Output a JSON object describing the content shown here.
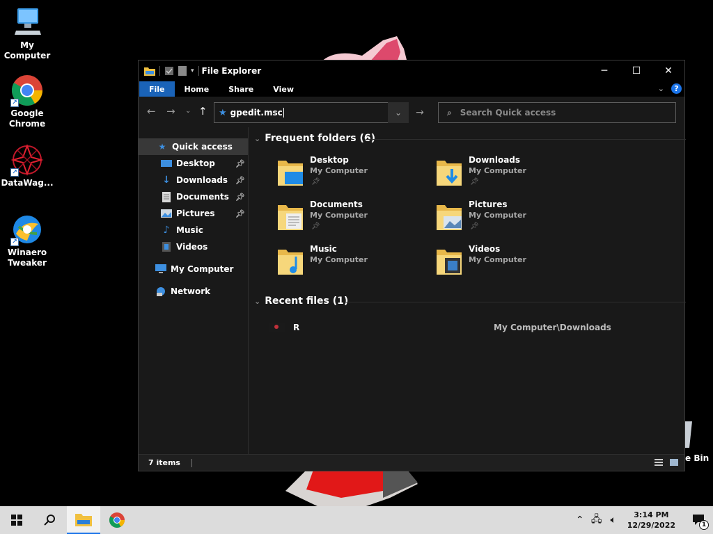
{
  "desktop": {
    "icons": [
      {
        "label": "My\nComputer",
        "name": "my-computer"
      },
      {
        "label": "Google\nChrome",
        "name": "google-chrome"
      },
      {
        "label": "DataWag...",
        "name": "datawag"
      },
      {
        "label": "Winaero\nTweaker",
        "name": "winaero-tweaker"
      }
    ],
    "recycle_bin_fragment": "e Bin"
  },
  "window": {
    "title": "File Explorer",
    "controls": {
      "minimize": "─",
      "maximize": "☐",
      "close": "✕"
    }
  },
  "ribbon": {
    "tabs": [
      "File",
      "Home",
      "Share",
      "View"
    ]
  },
  "address_bar": {
    "value": "gpedit.msc"
  },
  "search": {
    "placeholder": "Search Quick access"
  },
  "nav_pane": {
    "items": [
      {
        "label": "Quick access",
        "icon": "star-icon",
        "selected": true
      },
      {
        "label": "Desktop",
        "icon": "desktop-icon",
        "pinned": true
      },
      {
        "label": "Downloads",
        "icon": "download-icon",
        "pinned": true
      },
      {
        "label": "Documents",
        "icon": "document-icon",
        "pinned": true
      },
      {
        "label": "Pictures",
        "icon": "pictures-icon",
        "pinned": true
      },
      {
        "label": "Music",
        "icon": "music-icon"
      },
      {
        "label": "Videos",
        "icon": "video-icon"
      },
      {
        "label": "My Computer",
        "icon": "computer-icon"
      },
      {
        "label": "Network",
        "icon": "network-icon"
      }
    ]
  },
  "frequent": {
    "heading": "Frequent folders (6)",
    "folders": [
      {
        "name": "Desktop",
        "location": "My Computer",
        "pinned": true,
        "icon": "desktop-folder-icon"
      },
      {
        "name": "Downloads",
        "location": "My Computer",
        "pinned": true,
        "icon": "downloads-folder-icon"
      },
      {
        "name": "Documents",
        "location": "My Computer",
        "pinned": true,
        "icon": "documents-folder-icon"
      },
      {
        "name": "Pictures",
        "location": "My Computer",
        "pinned": true,
        "icon": "pictures-folder-icon"
      },
      {
        "name": "Music",
        "location": "My Computer",
        "pinned": false,
        "icon": "music-folder-icon"
      },
      {
        "name": "Videos",
        "location": "My Computer",
        "pinned": false,
        "icon": "videos-folder-icon"
      }
    ]
  },
  "recent": {
    "heading": "Recent files (1)",
    "files": [
      {
        "name": "R",
        "path": "My Computer\\Downloads"
      }
    ]
  },
  "status_bar": {
    "item_count": "7 items"
  },
  "taskbar": {
    "clock_time": "3:14 PM",
    "clock_date": "12/29/2022",
    "notification_count": "1"
  },
  "colors": {
    "accent": "#1a63b8",
    "window_bg": "#191919",
    "taskbar_bg": "#dcdcdc"
  }
}
